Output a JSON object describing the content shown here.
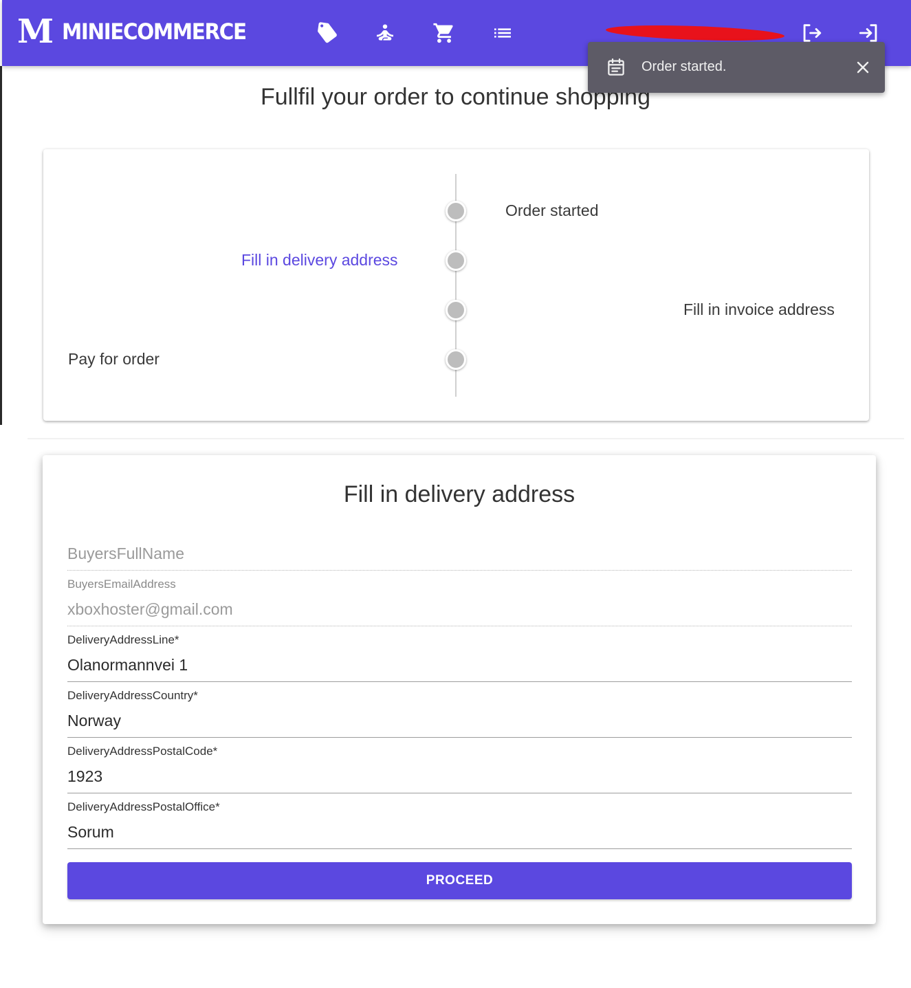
{
  "header": {
    "logo_letter": "M",
    "brand_name": "MINIECOMMERCE",
    "nav_icons": [
      "tag-icon",
      "yoga-icon",
      "shopping-cart-icon",
      "list-icon"
    ],
    "right_icons": [
      "logout-icon",
      "login-icon"
    ],
    "colors": {
      "bar": "#5b48e0",
      "redaction": "#e8121b"
    }
  },
  "snackbar": {
    "icon": "calendar-icon",
    "message": "Order started.",
    "close_icon": "close-icon"
  },
  "page": {
    "title": "Fullfil your order to continue shopping"
  },
  "timeline": {
    "steps": [
      {
        "label": "Order started",
        "side": "right",
        "active": false
      },
      {
        "label": "Fill in delivery address",
        "side": "left",
        "active": true
      },
      {
        "label": "Fill in invoice address",
        "side": "right",
        "active": false
      },
      {
        "label": "Pay for order",
        "side": "left",
        "active": false
      }
    ]
  },
  "form": {
    "title": "Fill in delivery address",
    "fields": [
      {
        "label": "",
        "placeholder": "BuyersFullName",
        "value": "",
        "disabled": true
      },
      {
        "label": "BuyersEmailAddress",
        "value": "xboxhoster@gmail.com",
        "disabled": true
      },
      {
        "label": "DeliveryAddressLine*",
        "value": "Olanormannvei 1",
        "disabled": false
      },
      {
        "label": "DeliveryAddressCountry*",
        "value": "Norway",
        "disabled": false
      },
      {
        "label": "DeliveryAddressPostalCode*",
        "value": "1923",
        "disabled": false
      },
      {
        "label": "DeliveryAddressPostalOffice*",
        "value": "Sorum",
        "disabled": false
      }
    ],
    "submit_label": "PROCEED"
  }
}
